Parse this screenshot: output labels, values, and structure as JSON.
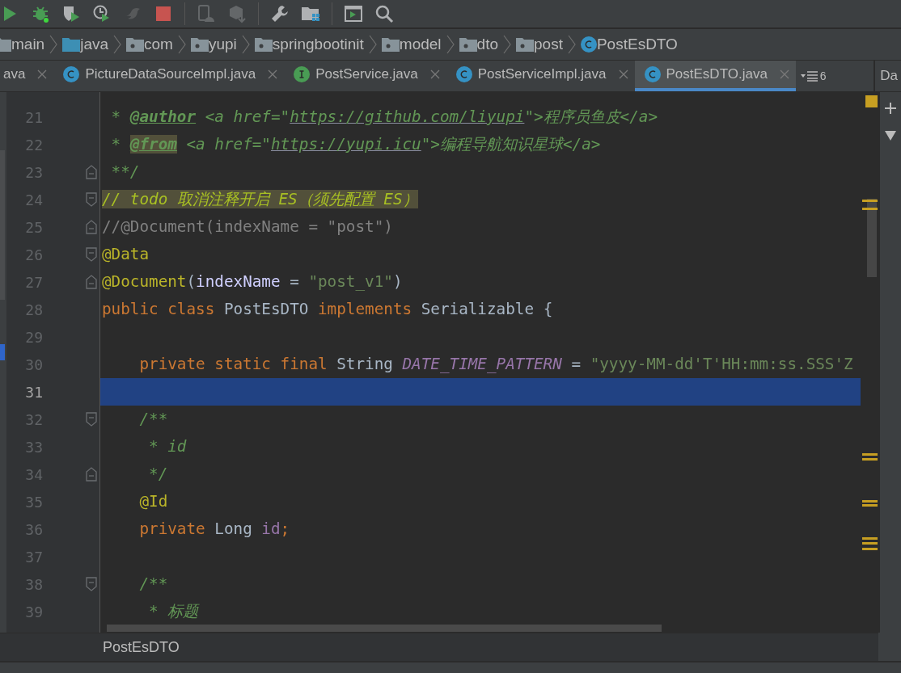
{
  "toolbar": {
    "groups": [
      [
        {
          "kind": "run",
          "disabled": false
        },
        {
          "kind": "debug",
          "disabled": false
        },
        {
          "kind": "coverage",
          "disabled": false
        },
        {
          "kind": "profile",
          "disabled": false
        },
        {
          "kind": "bird",
          "disabled": true
        },
        {
          "kind": "stop",
          "disabled": false
        }
      ],
      [
        {
          "kind": "device",
          "disabled": true
        },
        {
          "kind": "package",
          "disabled": true
        }
      ],
      [
        {
          "kind": "wrench",
          "disabled": false
        },
        {
          "kind": "structure",
          "disabled": false
        }
      ],
      [
        {
          "kind": "terminal",
          "disabled": false
        },
        {
          "kind": "search",
          "disabled": false
        }
      ]
    ]
  },
  "breadcrumbs": [
    {
      "label": "main",
      "kind": "folder"
    },
    {
      "label": "java",
      "kind": "source-folder"
    },
    {
      "label": "com",
      "kind": "package"
    },
    {
      "label": "yupi",
      "kind": "package"
    },
    {
      "label": "springbootinit",
      "kind": "package"
    },
    {
      "label": "model",
      "kind": "package"
    },
    {
      "label": "dto",
      "kind": "package"
    },
    {
      "label": "post",
      "kind": "package"
    },
    {
      "label": "PostEsDTO",
      "kind": "class"
    }
  ],
  "tabs": [
    {
      "label": "ava",
      "kind": "plain",
      "selected": false
    },
    {
      "label": "PictureDataSourceImpl.java",
      "kind": "class",
      "selected": false
    },
    {
      "label": "PostService.java",
      "kind": "interface",
      "selected": false
    },
    {
      "label": "PostServiceImpl.java",
      "kind": "class",
      "selected": false
    },
    {
      "label": "PostEsDTO.java",
      "kind": "class",
      "selected": true
    }
  ],
  "tabs_overflow": "6",
  "side_tab": "Da",
  "editor": {
    "lines": [
      {
        "number": "21",
        "kind": "plain",
        "current": false,
        "tokens": [
          {
            "kind": "doc",
            "text": " * "
          },
          {
            "kind": "doctag",
            "text": "@author"
          },
          {
            "kind": "doc",
            "text": " <a href=\""
          },
          {
            "kind": "doclink",
            "text": "https://github.com/liyupi"
          },
          {
            "kind": "doc",
            "text": "\">程序员鱼皮</a>"
          }
        ]
      },
      {
        "number": "22",
        "kind": "plain",
        "current": false,
        "tokens": [
          {
            "kind": "doc",
            "text": " * "
          },
          {
            "kind": "doctag-marked",
            "text": "@from"
          },
          {
            "kind": "doc",
            "text": " <a href=\""
          },
          {
            "kind": "doclink",
            "text": "https://yupi.icu"
          },
          {
            "kind": "doc",
            "text": "\">编程导航知识星球</a>"
          }
        ]
      },
      {
        "number": "23",
        "kind": "fold-end",
        "current": false,
        "tokens": [
          {
            "kind": "doc",
            "text": " **/"
          }
        ]
      },
      {
        "number": "24",
        "kind": "fold-start",
        "current": false,
        "tokens": [
          {
            "kind": "todo",
            "text": "// todo 取消注释开启 ES（须先配置 ES）"
          }
        ]
      },
      {
        "number": "25",
        "kind": "fold-end",
        "current": false,
        "tokens": [
          {
            "kind": "comment",
            "text": "//@Document(indexName = \"post\")"
          }
        ]
      },
      {
        "number": "26",
        "kind": "fold-start",
        "current": false,
        "tokens": [
          {
            "kind": "annotation",
            "text": "@Data"
          }
        ]
      },
      {
        "number": "27",
        "kind": "fold-end",
        "current": false,
        "tokens": [
          {
            "kind": "annotation",
            "text": "@Document"
          },
          {
            "kind": "plain",
            "text": "("
          },
          {
            "kind": "param",
            "text": "indexName"
          },
          {
            "kind": "plain",
            "text": " = "
          },
          {
            "kind": "string",
            "text": "\"post_v1\""
          },
          {
            "kind": "plain",
            "text": ")"
          }
        ]
      },
      {
        "number": "28",
        "kind": "plain",
        "current": false,
        "tokens": [
          {
            "kind": "keyword",
            "text": "public class "
          },
          {
            "kind": "plain",
            "text": "PostEsDTO "
          },
          {
            "kind": "keyword",
            "text": "implements "
          },
          {
            "kind": "plain",
            "text": "Serializable {"
          }
        ]
      },
      {
        "number": "29",
        "kind": "plain",
        "current": false
      },
      {
        "number": "30",
        "kind": "plain",
        "current": false,
        "tokens": [
          {
            "kind": "keyword",
            "text": "    private static final "
          },
          {
            "kind": "plain",
            "text": "String "
          },
          {
            "kind": "constant",
            "text": "DATE_TIME_PATTERN"
          },
          {
            "kind": "plain",
            "text": " = "
          },
          {
            "kind": "string",
            "text": "\"yyyy-MM-dd'T'HH:mm:ss.SSS'Z"
          }
        ]
      },
      {
        "number": "31",
        "kind": "plain",
        "current": true
      },
      {
        "number": "32",
        "kind": "fold-start",
        "current": false,
        "tokens": [
          {
            "kind": "doc",
            "text": "    /**"
          }
        ]
      },
      {
        "number": "33",
        "kind": "plain",
        "current": false,
        "tokens": [
          {
            "kind": "doc",
            "text": "     * id"
          }
        ]
      },
      {
        "number": "34",
        "kind": "fold-end",
        "current": false,
        "tokens": [
          {
            "kind": "doc",
            "text": "     */"
          }
        ]
      },
      {
        "number": "35",
        "kind": "plain",
        "current": false,
        "tokens": [
          {
            "kind": "annotation",
            "text": "    @Id"
          }
        ]
      },
      {
        "number": "36",
        "kind": "plain",
        "current": false,
        "tokens": [
          {
            "kind": "keyword",
            "text": "    private "
          },
          {
            "kind": "plain",
            "text": "Long "
          },
          {
            "kind": "field",
            "text": "id"
          },
          {
            "kind": "keyword",
            "text": ";"
          }
        ]
      },
      {
        "number": "37",
        "kind": "plain",
        "current": false
      },
      {
        "number": "38",
        "kind": "fold-start",
        "current": false,
        "tokens": [
          {
            "kind": "doc",
            "text": "    /**"
          }
        ]
      },
      {
        "number": "39",
        "kind": "plain",
        "current": false,
        "tokens": [
          {
            "kind": "doc",
            "text": "     * 标题"
          }
        ]
      }
    ]
  },
  "footer_breadcrumb": "PostEsDTO"
}
